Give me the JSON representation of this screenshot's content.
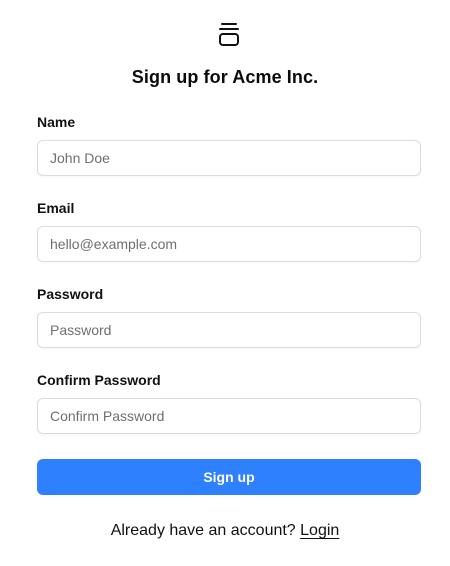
{
  "title": "Sign up for Acme Inc.",
  "logo": {
    "icon": "stacked-layers-icon"
  },
  "fields": [
    {
      "label": "Name",
      "placeholder": "John Doe",
      "value": ""
    },
    {
      "label": "Email",
      "placeholder": "hello@example.com",
      "value": ""
    },
    {
      "label": "Password",
      "placeholder": "Password",
      "value": ""
    },
    {
      "label": "Confirm Password",
      "placeholder": "Confirm Password",
      "value": ""
    }
  ],
  "submit": {
    "label": "Sign up"
  },
  "footer": {
    "text": "Already have an account?",
    "link_label": "Login"
  },
  "colors": {
    "primary": "#2f80ff",
    "text": "#111111",
    "border": "#dcdcdc",
    "placeholder": "#6f6f6f"
  }
}
